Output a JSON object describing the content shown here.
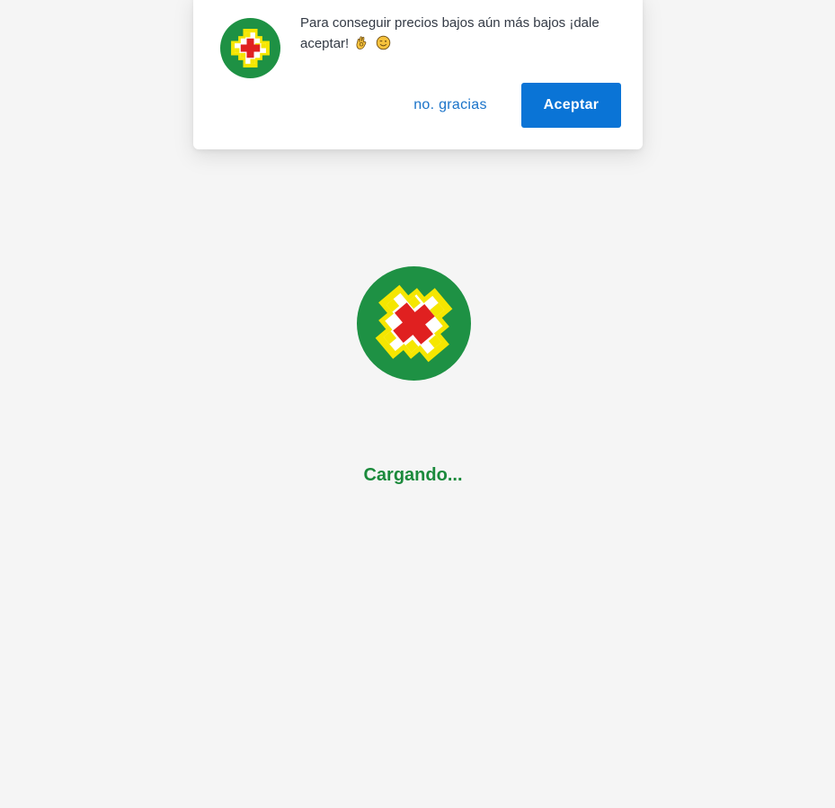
{
  "prompt": {
    "message": "Para conseguir precios bajos aún más bajos ¡dale aceptar!",
    "emojis": [
      "ok-hand-emoji",
      "winking-face-emoji"
    ],
    "decline_label": "no. gracias",
    "accept_label": "Aceptar"
  },
  "loader": {
    "text": "Cargando..."
  },
  "colors": {
    "background": "#f5f5f5",
    "brand_green": "#1b8a3c",
    "logo_green": "#1e9144",
    "logo_yellow": "#f5e600",
    "logo_red": "#e02020",
    "accent_blue": "#0a74d6",
    "link_blue": "#1a73c9"
  }
}
